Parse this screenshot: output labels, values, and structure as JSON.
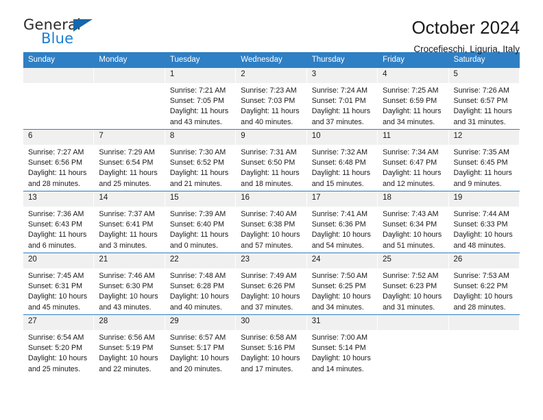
{
  "brand": {
    "name_top": "General",
    "name_bottom": "Blue",
    "color_dark": "#2b2b2b",
    "color_blue": "#1a7fd4",
    "triangle_color": "#1466ad"
  },
  "header": {
    "title": "October 2024",
    "subtitle": "Crocefieschi, Liguria, Italy"
  },
  "theme": {
    "header_row_bg": "#2f7fc4",
    "header_row_text": "#ffffff",
    "daynum_bg": "#f0f0f0",
    "cell_bg": "#ffffff",
    "grid_line": "#2f7fc4"
  },
  "weekdays": [
    "Sunday",
    "Monday",
    "Tuesday",
    "Wednesday",
    "Thursday",
    "Friday",
    "Saturday"
  ],
  "weeks": [
    [
      {
        "day": "",
        "blank": true,
        "sunrise": "",
        "sunset": "",
        "daylight": ""
      },
      {
        "day": "",
        "blank": true,
        "sunrise": "",
        "sunset": "",
        "daylight": ""
      },
      {
        "day": "1",
        "sunrise": "Sunrise: 7:21 AM",
        "sunset": "Sunset: 7:05 PM",
        "daylight": "Daylight: 11 hours and 43 minutes."
      },
      {
        "day": "2",
        "sunrise": "Sunrise: 7:23 AM",
        "sunset": "Sunset: 7:03 PM",
        "daylight": "Daylight: 11 hours and 40 minutes."
      },
      {
        "day": "3",
        "sunrise": "Sunrise: 7:24 AM",
        "sunset": "Sunset: 7:01 PM",
        "daylight": "Daylight: 11 hours and 37 minutes."
      },
      {
        "day": "4",
        "sunrise": "Sunrise: 7:25 AM",
        "sunset": "Sunset: 6:59 PM",
        "daylight": "Daylight: 11 hours and 34 minutes."
      },
      {
        "day": "5",
        "sunrise": "Sunrise: 7:26 AM",
        "sunset": "Sunset: 6:57 PM",
        "daylight": "Daylight: 11 hours and 31 minutes."
      }
    ],
    [
      {
        "day": "6",
        "sunrise": "Sunrise: 7:27 AM",
        "sunset": "Sunset: 6:56 PM",
        "daylight": "Daylight: 11 hours and 28 minutes."
      },
      {
        "day": "7",
        "sunrise": "Sunrise: 7:29 AM",
        "sunset": "Sunset: 6:54 PM",
        "daylight": "Daylight: 11 hours and 25 minutes."
      },
      {
        "day": "8",
        "sunrise": "Sunrise: 7:30 AM",
        "sunset": "Sunset: 6:52 PM",
        "daylight": "Daylight: 11 hours and 21 minutes."
      },
      {
        "day": "9",
        "sunrise": "Sunrise: 7:31 AM",
        "sunset": "Sunset: 6:50 PM",
        "daylight": "Daylight: 11 hours and 18 minutes."
      },
      {
        "day": "10",
        "sunrise": "Sunrise: 7:32 AM",
        "sunset": "Sunset: 6:48 PM",
        "daylight": "Daylight: 11 hours and 15 minutes."
      },
      {
        "day": "11",
        "sunrise": "Sunrise: 7:34 AM",
        "sunset": "Sunset: 6:47 PM",
        "daylight": "Daylight: 11 hours and 12 minutes."
      },
      {
        "day": "12",
        "sunrise": "Sunrise: 7:35 AM",
        "sunset": "Sunset: 6:45 PM",
        "daylight": "Daylight: 11 hours and 9 minutes."
      }
    ],
    [
      {
        "day": "13",
        "sunrise": "Sunrise: 7:36 AM",
        "sunset": "Sunset: 6:43 PM",
        "daylight": "Daylight: 11 hours and 6 minutes."
      },
      {
        "day": "14",
        "sunrise": "Sunrise: 7:37 AM",
        "sunset": "Sunset: 6:41 PM",
        "daylight": "Daylight: 11 hours and 3 minutes."
      },
      {
        "day": "15",
        "sunrise": "Sunrise: 7:39 AM",
        "sunset": "Sunset: 6:40 PM",
        "daylight": "Daylight: 11 hours and 0 minutes."
      },
      {
        "day": "16",
        "sunrise": "Sunrise: 7:40 AM",
        "sunset": "Sunset: 6:38 PM",
        "daylight": "Daylight: 10 hours and 57 minutes."
      },
      {
        "day": "17",
        "sunrise": "Sunrise: 7:41 AM",
        "sunset": "Sunset: 6:36 PM",
        "daylight": "Daylight: 10 hours and 54 minutes."
      },
      {
        "day": "18",
        "sunrise": "Sunrise: 7:43 AM",
        "sunset": "Sunset: 6:34 PM",
        "daylight": "Daylight: 10 hours and 51 minutes."
      },
      {
        "day": "19",
        "sunrise": "Sunrise: 7:44 AM",
        "sunset": "Sunset: 6:33 PM",
        "daylight": "Daylight: 10 hours and 48 minutes."
      }
    ],
    [
      {
        "day": "20",
        "sunrise": "Sunrise: 7:45 AM",
        "sunset": "Sunset: 6:31 PM",
        "daylight": "Daylight: 10 hours and 45 minutes."
      },
      {
        "day": "21",
        "sunrise": "Sunrise: 7:46 AM",
        "sunset": "Sunset: 6:30 PM",
        "daylight": "Daylight: 10 hours and 43 minutes."
      },
      {
        "day": "22",
        "sunrise": "Sunrise: 7:48 AM",
        "sunset": "Sunset: 6:28 PM",
        "daylight": "Daylight: 10 hours and 40 minutes."
      },
      {
        "day": "23",
        "sunrise": "Sunrise: 7:49 AM",
        "sunset": "Sunset: 6:26 PM",
        "daylight": "Daylight: 10 hours and 37 minutes."
      },
      {
        "day": "24",
        "sunrise": "Sunrise: 7:50 AM",
        "sunset": "Sunset: 6:25 PM",
        "daylight": "Daylight: 10 hours and 34 minutes."
      },
      {
        "day": "25",
        "sunrise": "Sunrise: 7:52 AM",
        "sunset": "Sunset: 6:23 PM",
        "daylight": "Daylight: 10 hours and 31 minutes."
      },
      {
        "day": "26",
        "sunrise": "Sunrise: 7:53 AM",
        "sunset": "Sunset: 6:22 PM",
        "daylight": "Daylight: 10 hours and 28 minutes."
      }
    ],
    [
      {
        "day": "27",
        "sunrise": "Sunrise: 6:54 AM",
        "sunset": "Sunset: 5:20 PM",
        "daylight": "Daylight: 10 hours and 25 minutes."
      },
      {
        "day": "28",
        "sunrise": "Sunrise: 6:56 AM",
        "sunset": "Sunset: 5:19 PM",
        "daylight": "Daylight: 10 hours and 22 minutes."
      },
      {
        "day": "29",
        "sunrise": "Sunrise: 6:57 AM",
        "sunset": "Sunset: 5:17 PM",
        "daylight": "Daylight: 10 hours and 20 minutes."
      },
      {
        "day": "30",
        "sunrise": "Sunrise: 6:58 AM",
        "sunset": "Sunset: 5:16 PM",
        "daylight": "Daylight: 10 hours and 17 minutes."
      },
      {
        "day": "31",
        "sunrise": "Sunrise: 7:00 AM",
        "sunset": "Sunset: 5:14 PM",
        "daylight": "Daylight: 10 hours and 14 minutes."
      },
      {
        "day": "",
        "blank": true,
        "sunrise": "",
        "sunset": "",
        "daylight": ""
      },
      {
        "day": "",
        "blank": true,
        "sunrise": "",
        "sunset": "",
        "daylight": ""
      }
    ]
  ]
}
